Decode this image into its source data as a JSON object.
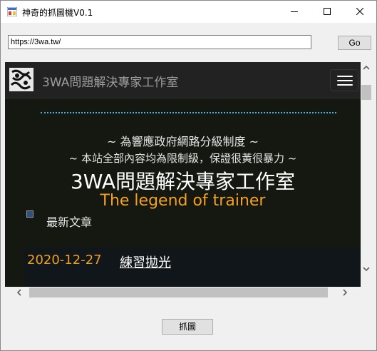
{
  "window": {
    "title": "神奇的抓圖機V0.1"
  },
  "toolbar": {
    "url": "https://3wa.tw/",
    "go_label": "Go"
  },
  "browser": {
    "brand": "3WA問題解決專家工作室",
    "hero": {
      "line1": "~ 為響應政府網路分級制度 ~",
      "line2": "~ 本站全部內容均為限制級，保證很黃很暴力 ~",
      "heading": "3WA問題解決專家工作室",
      "subtitle": "The legend of trainer"
    },
    "sidebar": {
      "label": "最新文章"
    },
    "posts": [
      {
        "date": "2020-12-27",
        "title": "練習拋光"
      }
    ]
  },
  "footer": {
    "capture_label": "抓圖"
  },
  "colors": {
    "accent_orange": "#f5a020",
    "divider_blue": "#3fb6e8",
    "page_bg": "#141810"
  }
}
